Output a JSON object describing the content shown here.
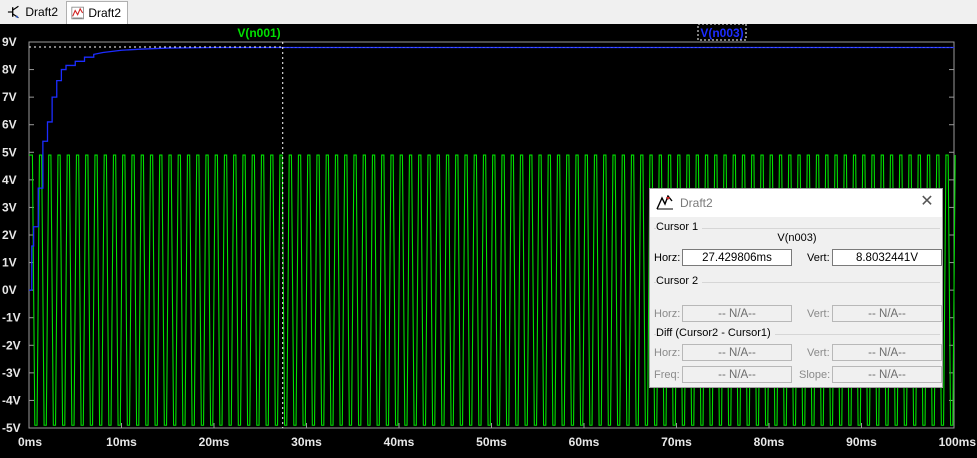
{
  "tabs": [
    {
      "label": "Draft2",
      "icon": "schematic-icon"
    },
    {
      "label": "Draft2",
      "icon": "waveform-icon"
    }
  ],
  "plot": {
    "background": "#000000",
    "trace_labels": [
      {
        "label": "V(n001)",
        "color": "#00e000"
      },
      {
        "label": "V(n003)",
        "color": "#1c2cff"
      }
    ]
  },
  "chart_data": {
    "type": "line",
    "title": "",
    "xlabel": "",
    "ylabel": "",
    "x_unit": "ms",
    "y_unit": "V",
    "xlim": [
      0,
      100
    ],
    "ylim": [
      -5,
      9
    ],
    "x_ticks": [
      "0ms",
      "10ms",
      "20ms",
      "30ms",
      "40ms",
      "50ms",
      "60ms",
      "70ms",
      "80ms",
      "90ms",
      "100ms"
    ],
    "y_ticks": [
      "9V",
      "8V",
      "7V",
      "6V",
      "5V",
      "4V",
      "3V",
      "2V",
      "1V",
      "0V",
      "-1V",
      "-2V",
      "-3V",
      "-4V",
      "-5V"
    ],
    "cursor_x_ms": 27.429806,
    "series": [
      {
        "name": "V(n001)",
        "color": "#00e000",
        "kind": "square-wave",
        "amplitude_v": 4.9,
        "cycles_over_window": 100,
        "x_range_ms": [
          0,
          100
        ]
      },
      {
        "name": "V(n003)",
        "color": "#1c2cff",
        "kind": "step-charge",
        "x": [
          0,
          0.3,
          0.5,
          1.0,
          1.5,
          2.0,
          2.5,
          3.0,
          3.5,
          4.0,
          5.0,
          6.0,
          7.0,
          8.0,
          10.0,
          12.0,
          15.0,
          20.0,
          27.4,
          100.0
        ],
        "y": [
          0.0,
          1.6,
          2.3,
          3.7,
          5.4,
          6.1,
          7.0,
          7.6,
          8.0,
          8.15,
          8.3,
          8.45,
          8.55,
          8.62,
          8.7,
          8.74,
          8.78,
          8.8,
          8.8,
          8.8
        ]
      }
    ]
  },
  "cursor_dialog": {
    "title": "Draft2",
    "cursor1": {
      "group": "Cursor 1",
      "trace": "V(n003)",
      "horz_label": "Horz:",
      "horz": "27.429806ms",
      "vert_label": "Vert:",
      "vert": "8.8032441V"
    },
    "cursor2": {
      "group": "Cursor 2",
      "horz_label": "Horz:",
      "horz": "-- N/A--",
      "vert_label": "Vert:",
      "vert": "-- N/A--"
    },
    "diff": {
      "group": "Diff (Cursor2 - Cursor1)",
      "horz_label": "Horz:",
      "horz": "-- N/A--",
      "vert_label": "Vert:",
      "vert": "-- N/A--",
      "freq_label": "Freq:",
      "freq": "-- N/A--",
      "slope_label": "Slope:",
      "slope": "-- N/A--"
    }
  }
}
